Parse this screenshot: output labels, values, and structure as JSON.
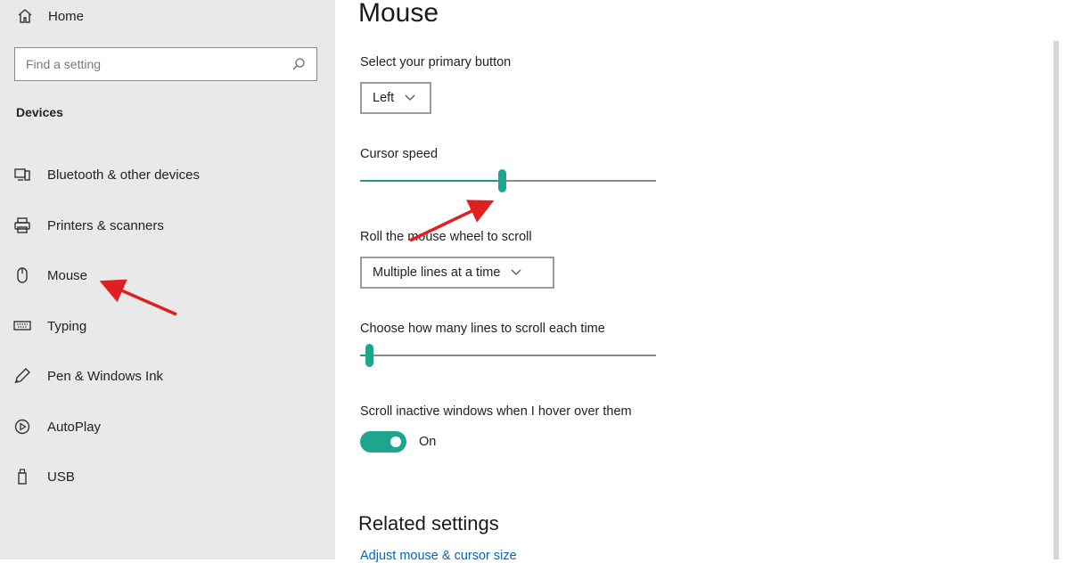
{
  "sidebar": {
    "home_label": "Home",
    "search_placeholder": "Find a setting",
    "section_title": "Devices",
    "items": [
      {
        "label": "Bluetooth & other devices",
        "icon": "bluetooth-devices-icon"
      },
      {
        "label": "Printers & scanners",
        "icon": "printer-icon"
      },
      {
        "label": "Mouse",
        "icon": "mouse-icon"
      },
      {
        "label": "Typing",
        "icon": "keyboard-icon"
      },
      {
        "label": "Pen & Windows Ink",
        "icon": "pen-icon"
      },
      {
        "label": "AutoPlay",
        "icon": "autoplay-icon"
      },
      {
        "label": "USB",
        "icon": "usb-icon"
      }
    ]
  },
  "main": {
    "title": "Mouse",
    "primary_button": {
      "label": "Select your primary button",
      "value": "Left"
    },
    "cursor_speed": {
      "label": "Cursor speed",
      "level": 0.48
    },
    "scroll_wheel": {
      "label": "Roll the mouse wheel to scroll",
      "value": "Multiple lines at a time"
    },
    "lines_to_scroll": {
      "label": "Choose how many lines to scroll each time",
      "level": 0.03
    },
    "inactive_scroll": {
      "label": "Scroll inactive windows when I hover over them",
      "state": "On"
    },
    "related_title": "Related settings",
    "related_link": "Adjust mouse & cursor size"
  },
  "colors": {
    "accent": "#1fa58d",
    "sidebar_bg": "#e9e9e9",
    "link": "#0067b8",
    "annotation_arrow": "#e02020"
  }
}
